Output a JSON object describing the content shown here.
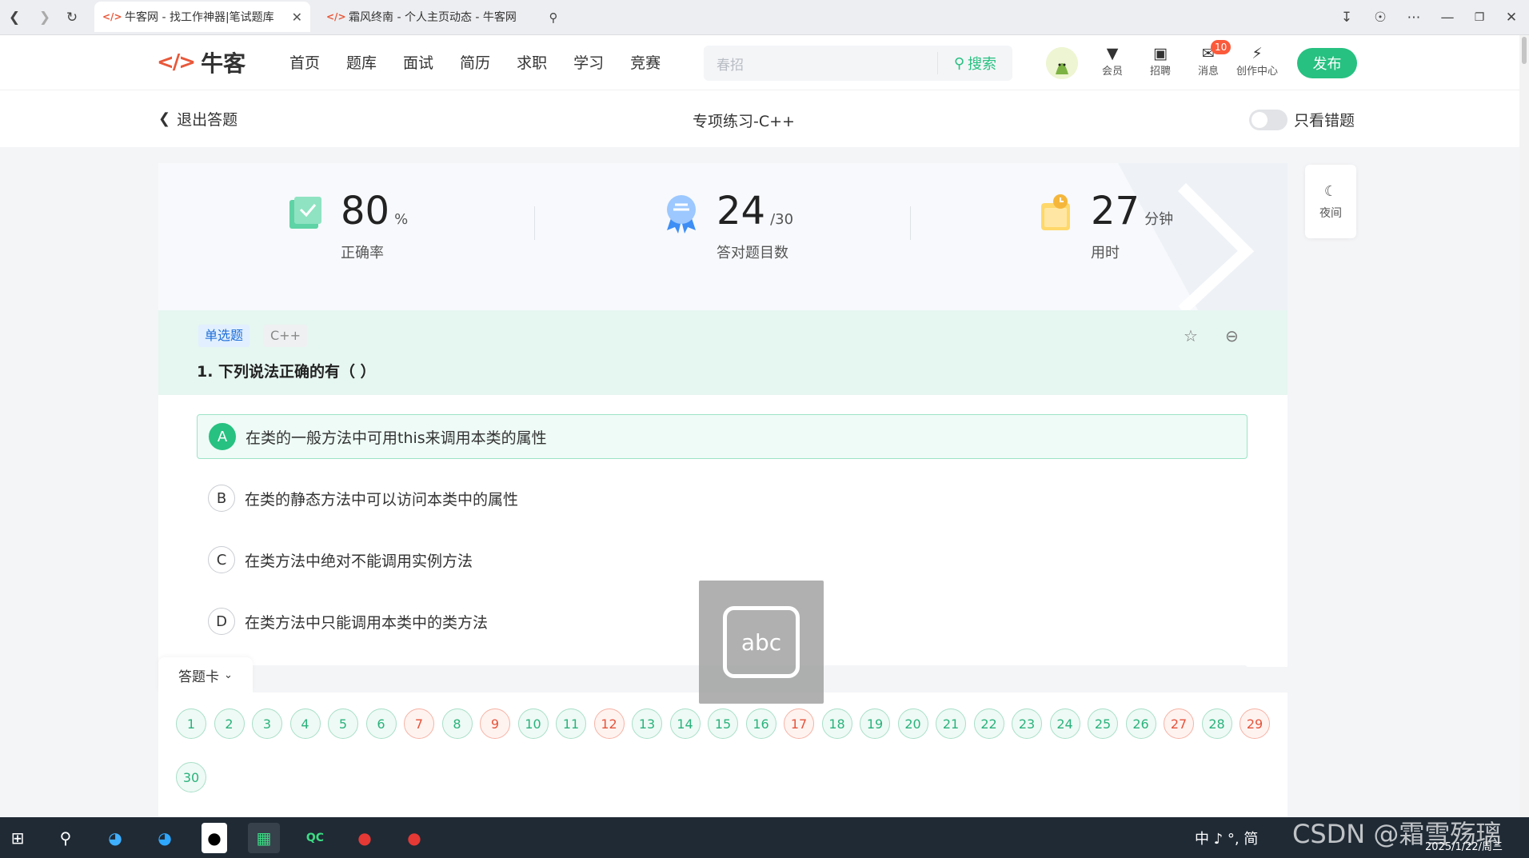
{
  "browser": {
    "tabs": [
      {
        "title": "牛客网 - 找工作神器|笔试题库",
        "active": true
      },
      {
        "title": "霜风终南 - 个人主页动态 - 牛客网",
        "active": false
      }
    ]
  },
  "nav": {
    "logo_text": "牛客",
    "links": [
      "首页",
      "题库",
      "面试",
      "简历",
      "求职",
      "学习",
      "竞赛"
    ],
    "search_placeholder": "春招",
    "search_button": "搜索",
    "icons": [
      {
        "label": "会员",
        "icon": "vip-icon"
      },
      {
        "label": "招聘",
        "icon": "recruit-icon"
      },
      {
        "label": "消息",
        "icon": "message-icon"
      },
      {
        "label": "创作中心",
        "icon": "lightning-icon"
      }
    ],
    "message_badge": "10",
    "publish": "发布"
  },
  "subheader": {
    "exit": "退出答题",
    "title": "专项练习-C++",
    "only_wrong": "只看错题"
  },
  "stats": {
    "accuracy": {
      "value": "80",
      "unit": "%",
      "label": "正确率"
    },
    "correct": {
      "value": "24",
      "unit": "/30",
      "label": "答对题目数"
    },
    "time": {
      "value": "27",
      "unit": "分钟",
      "label": "用时"
    }
  },
  "night_mode": "夜间",
  "question": {
    "type_tag": "单选题",
    "topic_tag": "C++",
    "title": "1. 下列说法正确的有（ ）",
    "options": [
      {
        "letter": "A",
        "text": "在类的一般方法中可用this来调用本类的属性",
        "selected": true
      },
      {
        "letter": "B",
        "text": "在类的静态方法中可以访问本类中的属性",
        "selected": false
      },
      {
        "letter": "C",
        "text": "在类方法中绝对不能调用实例方法",
        "selected": false
      },
      {
        "letter": "D",
        "text": "在类方法中只能调用本类中的类方法",
        "selected": false
      }
    ]
  },
  "answer_card": {
    "label": "答题卡",
    "numbers": [
      "1",
      "2",
      "3",
      "4",
      "5",
      "6",
      "7",
      "8",
      "9",
      "10",
      "11",
      "12",
      "13",
      "14",
      "15",
      "16",
      "17",
      "18",
      "19",
      "20",
      "21",
      "22",
      "23",
      "24",
      "25",
      "26",
      "27",
      "28",
      "29",
      "30"
    ],
    "wrong": [
      "7",
      "9",
      "12",
      "17",
      "27",
      "29"
    ]
  },
  "ime_overlay": "abc",
  "taskbar": {
    "tray": "中 ♪ °, 简",
    "date": "2025/1/22/周三"
  },
  "watermark": "CSDN @霜雪殇璃",
  "colors": {
    "accent": "#27c181",
    "wrong": "#e5533a",
    "brand": "#e8583a"
  }
}
